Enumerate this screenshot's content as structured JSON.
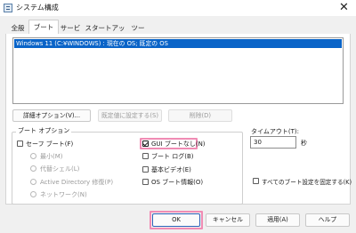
{
  "window": {
    "title": "システム構成",
    "close_label": "✕"
  },
  "tabs": [
    {
      "label": "全般"
    },
    {
      "label": "ブート"
    },
    {
      "label": "サービス"
    },
    {
      "label": "スタートアップ"
    },
    {
      "label": "ツール"
    }
  ],
  "os_list": {
    "entries": [
      "Windows 11 (C:¥WINDOWS) : 現在の OS; 既定の OS"
    ]
  },
  "actions": {
    "advanced": "詳細オプション(V)...",
    "set_default": "既定値に設定する(S)",
    "delete": "削除(D)"
  },
  "boot_options": {
    "title": "ブート オプション",
    "safe_boot": "セーフ ブート(F)",
    "minimal": "最小(M)",
    "alternate_shell": "代替シェル(L)",
    "active_directory": "Active Directory 修復(P)",
    "network": "ネットワーク(N)",
    "no_gui_boot": "GUI ブートなし(N)",
    "boot_log": "ブート ログ(B)",
    "base_video": "基本ビデオ(E)",
    "os_boot_info": "OS ブート情報(O)"
  },
  "timeout": {
    "label": "タイムアウト(T):",
    "value": "30",
    "unit": "秒"
  },
  "make_permanent": "すべてのブート設定を固定する(K)",
  "footer": {
    "ok": "OK",
    "cancel": "キャンセル",
    "apply": "適用(A)",
    "help": "ヘルプ"
  },
  "colors": {
    "selection": "#0a64c8",
    "highlight": "#f08cb4"
  }
}
